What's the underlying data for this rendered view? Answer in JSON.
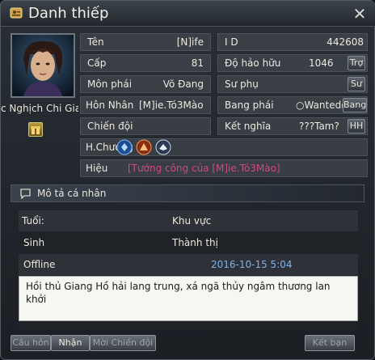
{
  "window": {
    "title": "Danh thiếp",
    "close_label": "✕"
  },
  "profile": {
    "nickname": "c Nghịch Chi Giao"
  },
  "fields": {
    "ten": {
      "label": "Tên",
      "value": "[N]ife"
    },
    "id": {
      "label": "I D",
      "value": "442608"
    },
    "cap": {
      "label": "Cấp",
      "value": "81"
    },
    "do_hao_huu": {
      "label": "Độ hảo hữu",
      "value": "1046"
    },
    "mon_phai": {
      "label": "Môn phái",
      "value": "Võ Đang"
    },
    "su_phu": {
      "label": "Sư phụ",
      "value": ""
    },
    "hon_nhan": {
      "label": "Hôn Nhân",
      "value": "[M]ie.Tó3Mào"
    },
    "bang_phai": {
      "label": "Bang phái",
      "value": "○Wanted○"
    },
    "chien_doi": {
      "label": "Chiến đội",
      "value": ""
    },
    "ket_nghia": {
      "label": "Kết nghĩa",
      "value": "???Tam?"
    },
    "h_chuong": {
      "label": "H.Chương"
    },
    "hieu": {
      "label": "Hiệu",
      "value": "[Tướng công của [M]ie.Tó3Mào]"
    }
  },
  "mini_buttons": {
    "tro": "Trợ",
    "su": "Sư",
    "bang": "Bang",
    "hh": "HH"
  },
  "personal": {
    "section_title": "Mô tả cá nhân",
    "tuoi_label": "Tuổi:",
    "khu_vuc_label": "Khu vực",
    "sinh_label": "Sinh",
    "thanh_thi_label": "Thành thị",
    "status": "Offline",
    "last_online": "2016-10-15 5:04",
    "bio": "Hồi thủ Giang Hồ hải lang trung, xá ngã thủy ngâm thương lan khởi"
  },
  "buttons": {
    "cau_hon": "Cầu hôn",
    "nhan": "Nhận",
    "moi_chien_doi": "Mời Chiến đội",
    "ket_ban": "Kết bạn"
  },
  "icons": {
    "title": "card-icon",
    "gift": "gift-icon",
    "medals": [
      "blue-medal-icon",
      "orange-medal-icon",
      "silver-medal-icon"
    ],
    "bubble": "speech-bubble-icon"
  },
  "colors": {
    "title_value": "#d04a7a",
    "date": "#7fb0e6"
  }
}
